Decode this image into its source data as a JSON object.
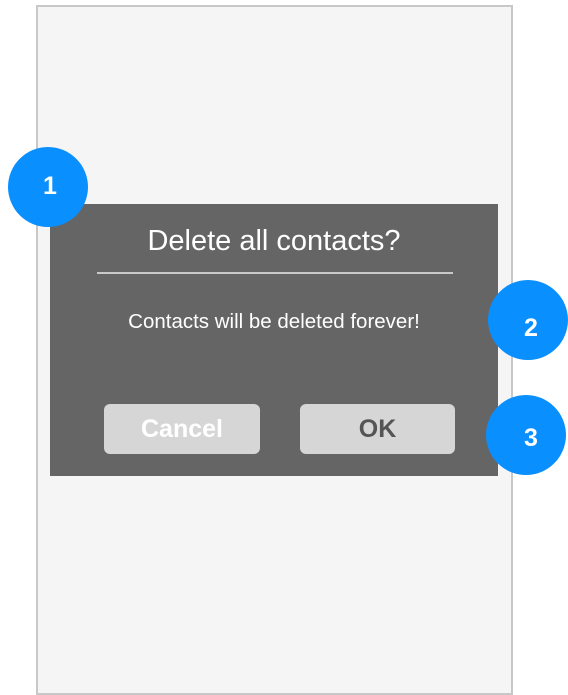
{
  "dialog": {
    "title": "Delete all contacts?",
    "message": "Contacts will be deleted forever!",
    "cancel_label": "Cancel",
    "ok_label": "OK"
  },
  "annotations": {
    "marker_1": "1",
    "marker_2": "2",
    "marker_3": "3"
  },
  "colors": {
    "dialog_background": "#656565",
    "button_background": "#d6d6d6",
    "marker_blue": "#0a8fff",
    "screen_background": "#f5f5f5"
  }
}
